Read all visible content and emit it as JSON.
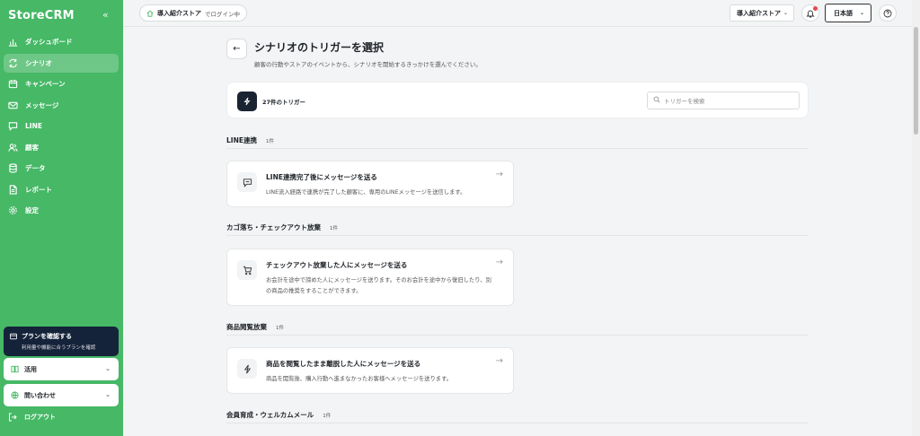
{
  "app": {
    "brand": "StoreCRM"
  },
  "sidebar": {
    "items": [
      {
        "label": "ダッシュボード",
        "icon": "bar-chart-icon",
        "active": false
      },
      {
        "label": "シナリオ",
        "icon": "refresh-icon",
        "active": true
      },
      {
        "label": "キャンペーン",
        "icon": "calendar-icon",
        "active": false
      },
      {
        "label": "メッセージ",
        "icon": "mail-icon",
        "active": false
      },
      {
        "label": "LINE",
        "icon": "chat-bubble-icon",
        "active": false
      },
      {
        "label": "顧客",
        "icon": "users-icon",
        "active": false
      },
      {
        "label": "データ",
        "icon": "database-icon",
        "active": false
      },
      {
        "label": "レポート",
        "icon": "document-icon",
        "active": false
      },
      {
        "label": "設定",
        "icon": "gear-icon",
        "active": false
      }
    ],
    "plan": {
      "title": "プランを確認する",
      "subtitle": "利用量や機能に合うプランを確認"
    },
    "accordion_1": "活用",
    "accordion_2": "問い合わせ",
    "logout": "ログアウト"
  },
  "topbar": {
    "store_name": "導入紹介ストア",
    "login_status": "でログイン中",
    "store_select": "導入紹介ストア",
    "language": "日本語"
  },
  "main": {
    "title": "シナリオのトリガーを選択",
    "description": "顧客の行動やストアのイベントから、シナリオを開始するきっかけを選んでください。",
    "trigger_count": "27件のトリガー",
    "search_placeholder": "トリガーを検索",
    "sections": [
      {
        "title": "LINE連携",
        "count": "1件",
        "card": {
          "title": "LINE連携完了後にメッセージを送る",
          "desc": "LINE流入経路で連携が完了した顧客に、専用のLINEメッセージを送信します。",
          "icon": "chat-bubble-icon"
        }
      },
      {
        "title": "カゴ落ち・チェックアウト放棄",
        "count": "1件",
        "card": {
          "title": "チェックアウト放棄した人にメッセージを送る",
          "desc": "お会計を途中で諦めた人にメッセージを送ります。そのお会計を途中から復旧したり、別の商品の推奨をすることができます。",
          "icon": "cart-icon"
        }
      },
      {
        "title": "商品閲覧放棄",
        "count": "1件",
        "card": {
          "title": "商品を閲覧したまま離脱した人にメッセージを送る",
          "desc": "商品を閲覧後、購入行動へ進まなかったお客様へメッセージを送ります。",
          "icon": "lightning-icon"
        }
      },
      {
        "title": "会員育成・ウェルカムメール",
        "count": "1件"
      }
    ]
  }
}
